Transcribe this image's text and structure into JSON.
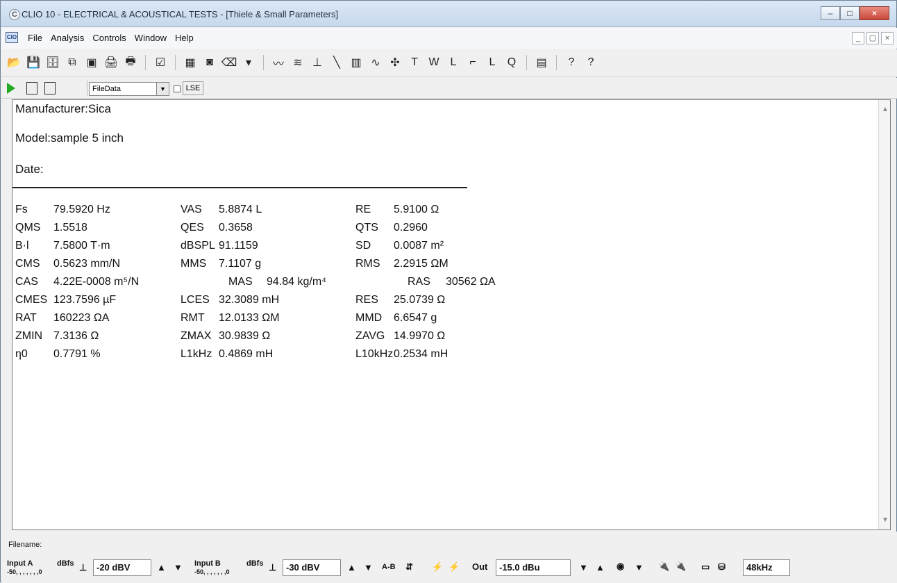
{
  "window": {
    "title": "CLIO 10 - ELECTRICAL & ACOUSTICAL TESTS - [Thiele & Small Parameters]",
    "controls": [
      "–",
      "□",
      "×"
    ]
  },
  "menu": {
    "app_icon": "CIO",
    "items": [
      "File",
      "Analysis",
      "Controls",
      "Window",
      "Help"
    ],
    "mdi_controls": [
      "_",
      "▢",
      "×"
    ]
  },
  "toolbar": {
    "icons": [
      "open-icon",
      "save-icon",
      "save-all-icon",
      "copy-icon",
      "export-icon",
      "print-preview-icon",
      "print-icon",
      "checklist-icon",
      "film-icon",
      "camera-icon",
      "eraser-icon",
      "dropdown-icon",
      "chart-icon",
      "waterfall-icon",
      "impulse-icon",
      "slope-icon",
      "bars-icon",
      "sine-icon",
      "rotate-icon",
      "ts-icon",
      "wf-icon",
      "leq-icon",
      "step-icon",
      "lr-icon",
      "qc-icon",
      "monitor-icon",
      "help-icon",
      "context-help-icon"
    ]
  },
  "controls": {
    "file_data": "FileData",
    "lse": "LSE"
  },
  "document": {
    "manufacturer": "Manufacturer:Sica",
    "model": "Model:sample 5 inch",
    "date": "Date:",
    "params": [
      {
        "symbol": "Fs",
        "value": "79.5920 Hz"
      },
      {
        "symbol": "VAS",
        "value": "5.8874 L"
      },
      {
        "symbol": "RE",
        "value": "5.9100 Ω"
      },
      {
        "symbol": "QMS",
        "value": "1.5518"
      },
      {
        "symbol": "QES",
        "value": "0.3658"
      },
      {
        "symbol": "QTS",
        "value": "0.2960"
      },
      {
        "symbol": "B·l",
        "value": "7.5800 T·m"
      },
      {
        "symbol": "dBSPL",
        "value": "91.1159"
      },
      {
        "symbol": "SD",
        "value": "0.0087 m²"
      },
      {
        "symbol": "CMS",
        "value": "0.5623 mm/N"
      },
      {
        "symbol": "MMS",
        "value": "7.1107 g"
      },
      {
        "symbol": "RMS",
        "value": "2.2915 ΩM"
      },
      {
        "symbol": "CAS",
        "value": "4.22E-0008 m⁵/N"
      },
      {
        "symbol": "MAS",
        "value": "94.84 kg/m⁴"
      },
      {
        "symbol": "RAS",
        "value": "30562 ΩA"
      },
      {
        "symbol": "CMES",
        "value": "123.7596 µF"
      },
      {
        "symbol": "LCES",
        "value": "32.3089 mH"
      },
      {
        "symbol": "RES",
        "value": "25.0739 Ω"
      },
      {
        "symbol": "RAT",
        "value": "160223 ΩA"
      },
      {
        "symbol": "RMT",
        "value": "12.0133 ΩM"
      },
      {
        "symbol": "MMD",
        "value": "6.6547 g"
      },
      {
        "symbol": "ZMIN",
        "value": "7.3136 Ω"
      },
      {
        "symbol": "ZMAX",
        "value": "30.9839 Ω"
      },
      {
        "symbol": "ZAVG",
        "value": "14.9970 Ω"
      },
      {
        "symbol": "η0",
        "value": "0.7791 %"
      },
      {
        "symbol": "L1kHz",
        "value": "0.4869 mH"
      },
      {
        "symbol": "L10kHz",
        "value": "0.2534 mH"
      }
    ]
  },
  "status": {
    "filename": "Filename:",
    "input_a": "Input A",
    "input_a_scale": "-50, , , , , , ,0",
    "dbfs": "dBfs",
    "input_a_value": "-20 dBV",
    "input_b": "Input B",
    "input_b_scale": "-50, , , , , , ,0",
    "input_b_value": "-30 dBV",
    "ab": "A-B",
    "out": "Out",
    "out_value": "-15.0 dBu",
    "sample_rate": "48kHz"
  }
}
